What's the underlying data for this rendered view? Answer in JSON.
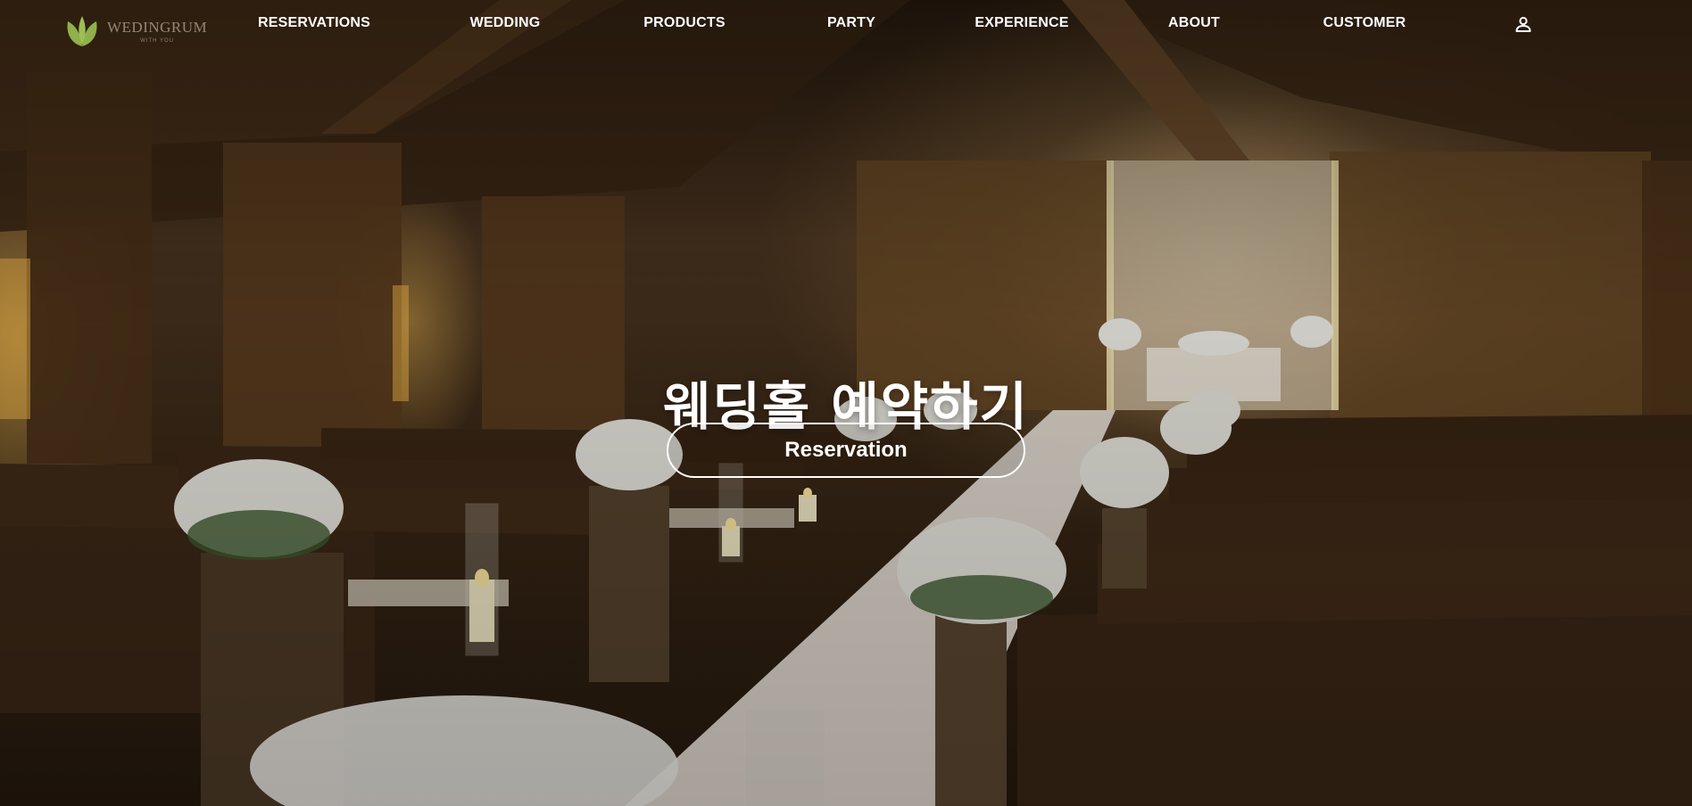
{
  "brand": {
    "name": "WEDINGRUM",
    "tagline": "WITH YOU",
    "icon": "leaf-logo-icon",
    "logo_color": "#8fb04a"
  },
  "nav": {
    "items": [
      {
        "label": "RESERVATIONS"
      },
      {
        "label": "WEDDING"
      },
      {
        "label": "PRODUCTS"
      },
      {
        "label": "PARTY"
      },
      {
        "label": "EXPERIENCE"
      },
      {
        "label": "ABOUT"
      },
      {
        "label": "CUSTOMER"
      }
    ],
    "user_icon": "user-account-icon"
  },
  "hero": {
    "title": "웨딩홀 예약하기",
    "button_label": "Reservation",
    "background": "wedding chapel interior"
  },
  "colors": {
    "text": "#ffffff",
    "button_border": "#ffffff"
  }
}
